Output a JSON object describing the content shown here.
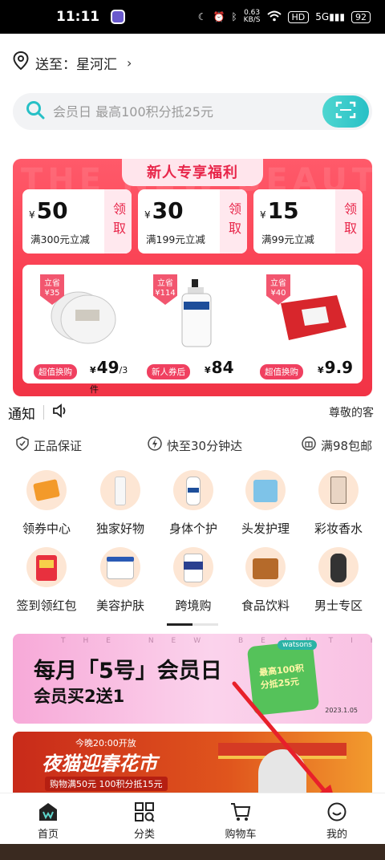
{
  "status_bar": {
    "time": "11:11",
    "speed": "0.63",
    "speed_unit": "KB/S",
    "hd": "HD",
    "signal": "5G",
    "battery": "92"
  },
  "address": {
    "label": "送至：星河汇"
  },
  "search": {
    "placeholder": "会员日 最高100积分抵25元"
  },
  "new_user": {
    "bg_text": "THE NEW BEAUTIFUL",
    "title": "新人专享福利",
    "coupons": [
      {
        "currency": "¥",
        "amount": "50",
        "condition": "满300元立减",
        "claim": "领取"
      },
      {
        "currency": "¥",
        "amount": "30",
        "condition": "满199元立减",
        "claim": "领取"
      },
      {
        "currency": "¥",
        "amount": "15",
        "condition": "满99元立减",
        "claim": "领取"
      }
    ],
    "products": [
      {
        "tag_top": "立省",
        "tag_val": "¥35",
        "badge": "超值换购",
        "currency": "¥",
        "price": "49",
        "unit": "/3件"
      },
      {
        "tag_top": "立省",
        "tag_val": "¥114",
        "badge": "新人券后",
        "currency": "¥",
        "price": "84",
        "unit": ""
      },
      {
        "tag_top": "立省",
        "tag_val": "¥40",
        "badge": "超值换购",
        "currency": "¥",
        "price": "9.9",
        "unit": ""
      }
    ]
  },
  "notice": {
    "label": "通知",
    "text": "尊敬的客"
  },
  "guarantees": [
    "正品保证",
    "快至30分钟达",
    "满98包邮"
  ],
  "categories": [
    {
      "label": "领券中心"
    },
    {
      "label": "独家好物"
    },
    {
      "label": "身体个护"
    },
    {
      "label": "头发护理"
    },
    {
      "label": "彩妆香水"
    },
    {
      "label": "签到领红包"
    },
    {
      "label": "美容护肤"
    },
    {
      "label": "跨境购"
    },
    {
      "label": "食品饮料"
    },
    {
      "label": "男士专区"
    }
  ],
  "promo1": {
    "bg_text": "THE NEW BEAUTIFUL",
    "line1": "每月「5号」会员日",
    "line2": "会员买2送1",
    "brand": "watsons",
    "cube_text": "最高100积分抵25元",
    "date": "2023.1.05"
  },
  "promo2": {
    "sub": "今晚20:00开放",
    "main": "夜猫迎春花市",
    "bottom": "购物满50元 100积分抵15元"
  },
  "tabs": [
    {
      "label": "首页",
      "icon": "home-icon"
    },
    {
      "label": "分类",
      "icon": "category-icon"
    },
    {
      "label": "购物车",
      "icon": "cart-icon"
    },
    {
      "label": "我的",
      "icon": "profile-icon"
    }
  ],
  "colors": {
    "accent_red": "#f83a4d",
    "teal": "#27c0c6",
    "coupon_pink": "#ffe8ee"
  }
}
